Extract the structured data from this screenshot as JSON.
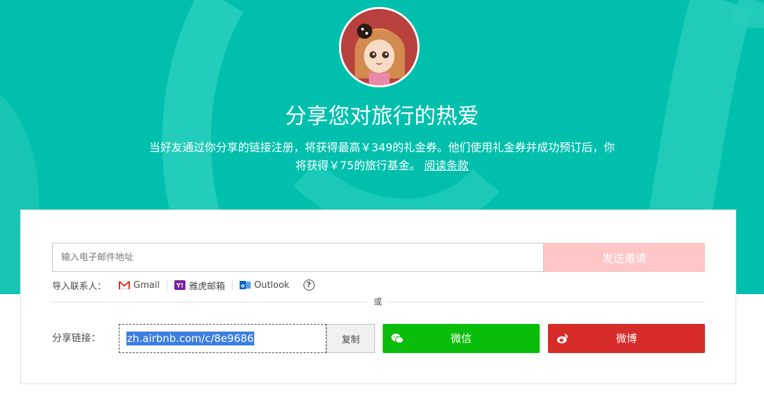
{
  "hero": {
    "title": "分享您对旅行的热爱",
    "subtitle_line1": "当好友通过你分享的链接注册，将获得最高￥349的礼金券。他们使用礼金券并成功预订后，你",
    "subtitle_line2": "将获得￥75的旅行基金。",
    "terms_link": "阅读条款"
  },
  "invite": {
    "email_placeholder": "输入电子邮件地址",
    "send_label": "发送邀请"
  },
  "contacts": {
    "label": "导入联系人：",
    "providers": [
      {
        "name": "Gmail",
        "icon": "gmail-icon"
      },
      {
        "name": "雅虎邮箱",
        "icon": "yahoo-icon"
      },
      {
        "name": "Outlook",
        "icon": "outlook-icon"
      }
    ],
    "help": "?"
  },
  "divider_text": "或",
  "share": {
    "label": "分享链接：",
    "link": "zh.airbnb.com/c/8e9686",
    "copy_label": "复制",
    "wechat_label": "微信",
    "weibo_label": "微博"
  },
  "colors": {
    "hero_bg": "#00c0ad",
    "send_disabled": "#ffc6c7",
    "wechat": "#0bbd0b",
    "weibo": "#d72b29",
    "selection": "#3d7ee1"
  }
}
